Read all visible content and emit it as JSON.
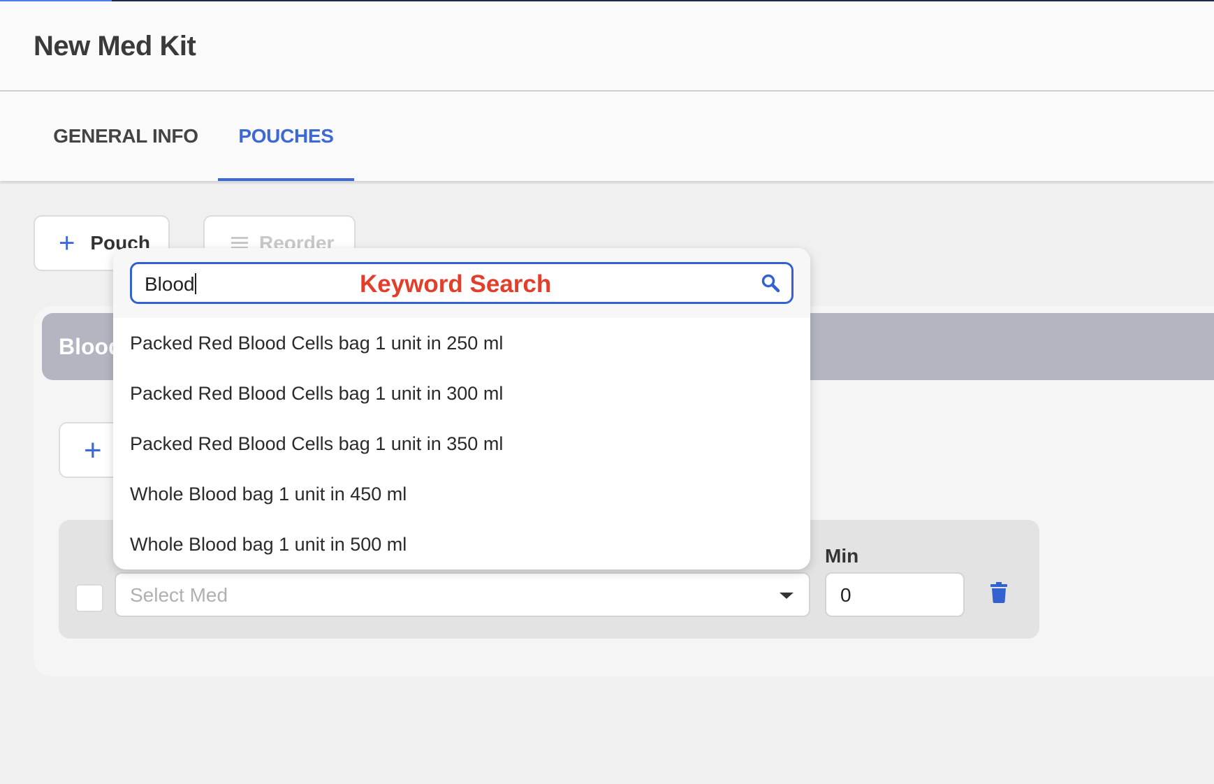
{
  "header": {
    "title": "New Med Kit"
  },
  "tabs": [
    {
      "label": "GENERAL INFO",
      "active": false
    },
    {
      "label": "POUCHES",
      "active": true
    }
  ],
  "toolbar": {
    "add_pouch_label": "Pouch",
    "reorder_label": "Reorder"
  },
  "pouch": {
    "name": "Blood"
  },
  "med_row": {
    "select_placeholder": "Select Med",
    "min_label": "Min",
    "min_value": "0"
  },
  "search": {
    "value": "Blood",
    "annotation": "Keyword Search"
  },
  "options": [
    "Packed Red Blood Cells bag 1 unit in 250 ml",
    "Packed Red Blood Cells bag 1 unit in 300 ml",
    "Packed Red Blood Cells bag 1 unit in 350 ml",
    "Whole Blood bag 1 unit in 450 ml",
    "Whole Blood bag 1 unit in 500 ml"
  ],
  "colors": {
    "accent": "#3c68d8",
    "annotation": "#e33e2a",
    "pouch_header": "#b3b5c1"
  }
}
